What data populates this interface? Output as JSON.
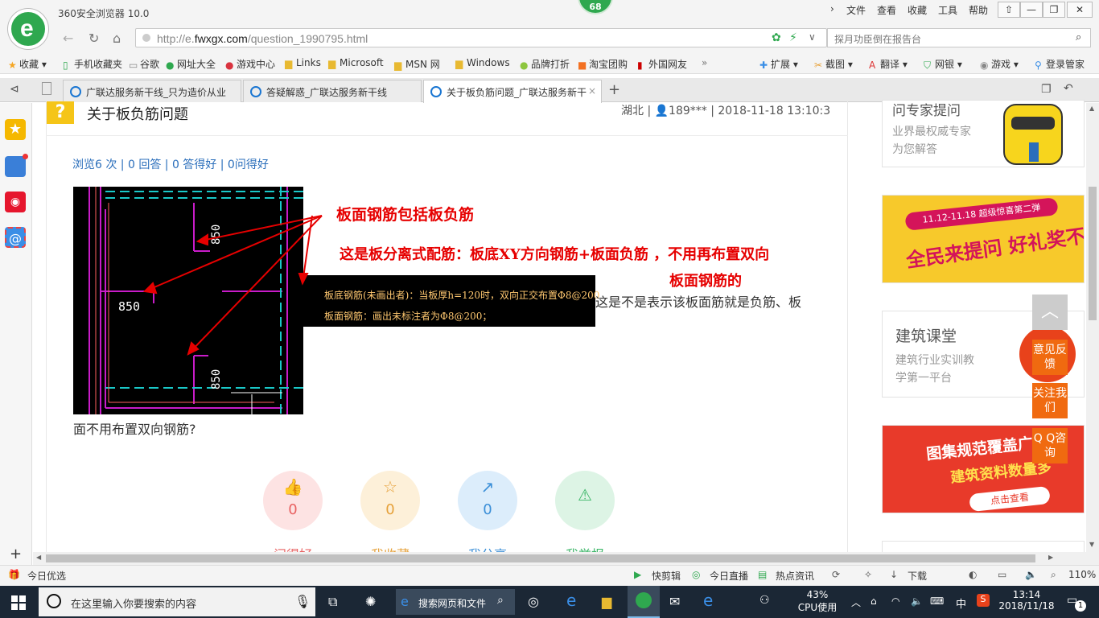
{
  "app": {
    "name": "360安全浏览器 10.0",
    "badge": "68"
  },
  "menu": [
    "文件",
    "查看",
    "收藏",
    "工具",
    "帮助"
  ],
  "window_controls": {
    "pin": "⇧",
    "min": "—",
    "restore": "❐",
    "close": "✕"
  },
  "nav": {
    "back": "←",
    "refresh": "↻",
    "home": "⌂",
    "url_prefix": "http://e.",
    "url_domain": "fwxgx.com",
    "url_path": "/question_1990795.html",
    "search_placeholder": "探月功臣倒在报告台"
  },
  "bookmarks": {
    "left": [
      "收藏",
      "手机收藏夹",
      "谷歌",
      "网址大全",
      "游戏中心",
      "Links",
      "Microsoft",
      "MSN 网",
      "Windows",
      "品牌打折",
      "淘宝团购",
      "外国网友"
    ],
    "more": "»",
    "right": [
      "扩展",
      "截图",
      "翻译",
      "网银",
      "游戏",
      "登录管家"
    ]
  },
  "tabs": [
    {
      "label": "广联达服务新干线_只为造价从业",
      "active": false
    },
    {
      "label": "答疑解惑_广联达服务新干线",
      "active": false
    },
    {
      "label": "关于板负筋问题_广联达服务新干",
      "active": true
    }
  ],
  "new_tab": "+",
  "question": {
    "icon": "?",
    "title": "关于板负筋问题",
    "meta": "湖北 | 👤189*** | 2018-11-18 13:10:3",
    "stats": "浏览6 次 | 0 回答 | 0 答得好 | 0问得好",
    "body_right": "这是不是表示该板面筋就是负筋、板",
    "body_bottom": "面不用布置双向钢筋?",
    "annot1": "板面钢筋包括板负筋",
    "annot2": "这是板分离式配筋：板底XY方向钢筋+板面负筋 ，不用再布置双向",
    "annot3": "板面钢筋的",
    "cad_popup_1": "板底钢筋(未画出者)：当板厚h=120时，双向正交布置Φ8@200",
    "cad_popup_2": "板面钢筋：画出未标注者为Φ8@200；",
    "cad_dims": [
      "850",
      "850",
      "850"
    ]
  },
  "actions": [
    {
      "label": "问得好",
      "count": "0",
      "color": "#e86262",
      "bg": "#fde3e3",
      "icon": "👍"
    },
    {
      "label": "我收藏",
      "count": "0",
      "color": "#e6a13a",
      "bg": "#fdf0d9",
      "icon": "☆"
    },
    {
      "label": "我分享",
      "count": "0",
      "color": "#3b8fd8",
      "bg": "#dcedfb",
      "icon": "↗"
    },
    {
      "label": "我举报",
      "count": "0",
      "color": "#3eb76a",
      "bg": "#ddf4e5",
      "icon": "⚠"
    }
  ],
  "ads": {
    "expert_title": "问专家提问",
    "expert_sub1": "业界最权威专家",
    "expert_sub2": "为您解答",
    "promo_date": "11.12-11.18 超级惊喜第二弹",
    "promo_main": "全民来提问 好礼奖不停",
    "course_title": "建筑课堂",
    "course_sub1": "建筑行业实训教",
    "course_sub2": "学第一平台",
    "atlas_main": "图集规范覆盖广",
    "atlas_sub": "建筑资料数量多",
    "atlas_btn": "点击查看"
  },
  "float": {
    "top": "︿",
    "feedback": "意见反馈",
    "follow": "关注我们",
    "qq": "Q Q咨询"
  },
  "status": {
    "left": "今日优选",
    "items": [
      "快剪辑",
      "今日直播",
      "热点资讯"
    ],
    "download": "下载",
    "zoom": "110%"
  },
  "taskbar": {
    "search_placeholder": "在这里输入你要搜索的内容",
    "search_web": "搜索网页和文件",
    "cpu_percent": "43%",
    "cpu_label": "CPU使用",
    "ime": "中",
    "time": "13:14",
    "date": "2018/11/18",
    "notif": "1"
  }
}
